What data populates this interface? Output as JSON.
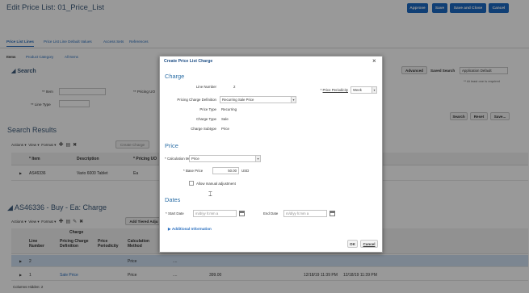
{
  "page": {
    "title": "Edit Price List: 01_Price_List",
    "buttons": [
      "Approve",
      "Save",
      "Save and Close",
      "Cancel"
    ]
  },
  "tabs": [
    "Price List Lines",
    "Price List Line Default Values",
    "Access Sets",
    "References"
  ],
  "subtabs": [
    "Items",
    "Product Category",
    "All Items"
  ],
  "search": {
    "title": "Search",
    "advanced": "Advanced",
    "saved_label": "Saved Search",
    "saved_value": "Application Default",
    "required_note": "** At least one is required",
    "item_label": "** Item",
    "pricing_uom_label": "** Pricing UO",
    "line_type_label": "** Line Type",
    "buttons": [
      "Search",
      "Reset",
      "Save..."
    ]
  },
  "results": {
    "title": "Search Results",
    "toolbar": [
      "Actions",
      "View",
      "Format"
    ],
    "create_charge": "Create Charge",
    "columns": [
      "* Item",
      "Description",
      "* Pricing UO"
    ],
    "row": {
      "item": "AS46336",
      "description": "Vario 6000 Tablet",
      "uom": "Ea"
    }
  },
  "charges": {
    "title": "AS46336 - Buy - Ea: Charge",
    "toolbar": [
      "Actions",
      "View",
      "Format"
    ],
    "add_tiered": "Add Tiered Adju",
    "group_header": "Charge",
    "columns": [
      "Line Number",
      "Pricing Charge Definition",
      "Price Periodicity",
      "Calculation Method"
    ],
    "rows": [
      {
        "line": "2",
        "definition": "",
        "method": "Price",
        "dots": "....",
        "amount": "",
        "start": "",
        "end": ""
      },
      {
        "line": "1",
        "definition": "Sale Price",
        "method": "Price",
        "dots": "....",
        "amount": "399.00",
        "start": "12/18/19 11:39 PM",
        "end": "12/18/19 11:39 PM"
      }
    ],
    "columns_hidden": "Columns Hidden: 2"
  },
  "dialog": {
    "title": "Create Price List Charge",
    "charge_section": "Charge",
    "line_number_label": "Line Number",
    "line_number_value": "2",
    "price_periodicity_label": "Price Periodicity",
    "price_periodicity_value": "Week",
    "pcd_label": "Pricing Charge Definition",
    "pcd_value": "Recurring Sale Price",
    "price_type_label": "Price Type",
    "price_type_value": "Recurring",
    "charge_type_label": "Charge Type",
    "charge_type_value": "Sale",
    "charge_subtype_label": "Charge Subtype",
    "charge_subtype_value": "Price",
    "price_section": "Price",
    "calc_method_label": "Calculation Method",
    "calc_method_value": "Price",
    "base_price_label": "Base Price",
    "base_price_value": "50.00",
    "currency": "USD",
    "allow_manual": "Allow manual adjustment",
    "dates_section": "Dates",
    "start_date_label": "Start Date",
    "end_date_label": "End Date",
    "date_placeholder": "m/d/yy h:mm a",
    "additional_info": "Additional Information",
    "ok": "OK",
    "cancel": "Cancel"
  }
}
